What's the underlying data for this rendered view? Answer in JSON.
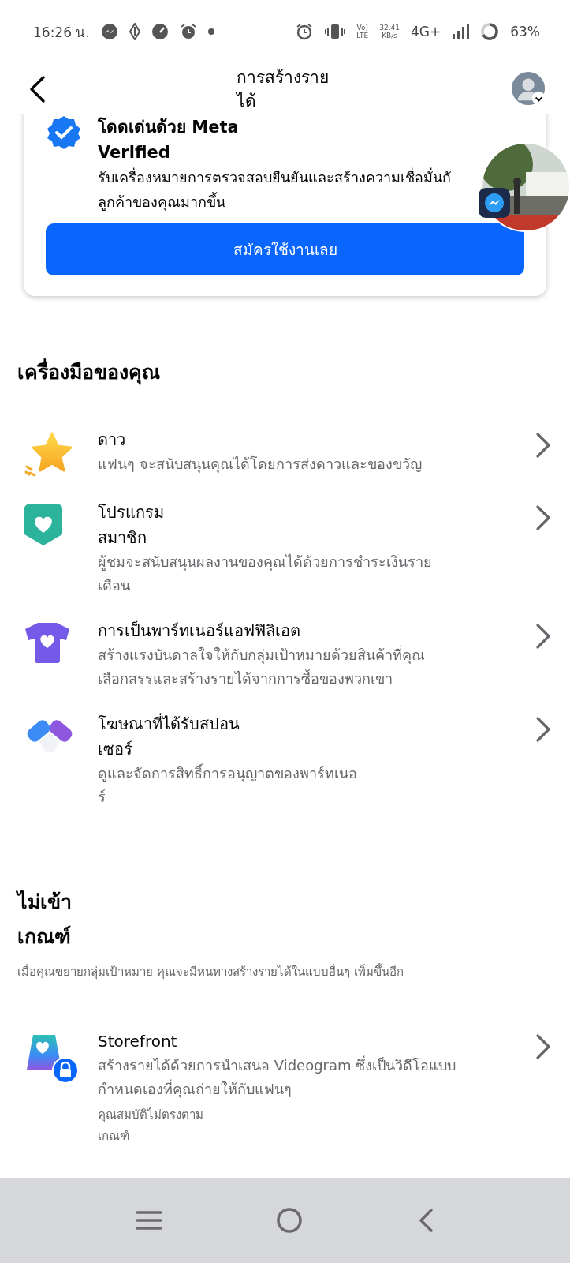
{
  "status_bar": {
    "time": "16:26 น.",
    "volte": [
      "Vo)",
      "LTE"
    ],
    "speed": [
      "32.41",
      "KB/s"
    ],
    "network": "4G+",
    "battery": "63%"
  },
  "header": {
    "title_lines": [
      "การสร้างราย",
      "ได้"
    ]
  },
  "verified_card": {
    "title_lines": [
      "โดดเด่นด้วย Meta",
      "Verified"
    ],
    "description_lines": [
      "รับเครื่องหมายการตรวจสอบยืนยันและสร้างความเชื่อมั่นกั",
      "ลูกค้าของคุณมากขึ้น"
    ],
    "button": "สมัครใช้งานเลย"
  },
  "tools": {
    "heading": "เครื่องมือของคุณ",
    "items": [
      {
        "title_lines": [
          "ดาว"
        ],
        "description_lines": [
          "แฟนๆ จะสนับสนุนคุณได้โดยการส่งดาวและของขวัญ"
        ],
        "locked": false
      },
      {
        "title_lines": [
          "โปรแกรม",
          "สมาชิก"
        ],
        "description_lines": [
          "ผู้ชมจะสนับสนุนผลงานของคุณได้ด้วยการชำระเงินราย",
          "เดือน"
        ],
        "locked": false
      },
      {
        "title_lines": [
          "การเป็นพาร์ทเนอร์แอฟฟิลิเอต"
        ],
        "description_lines": [
          "สร้างแรงบันดาลใจให้กับกลุ่มเป้าหมายด้วยสินค้าที่คุณ",
          "เลือกสรรและสร้างรายได้จากการซื้อของพวกเขา"
        ],
        "locked": false
      },
      {
        "title_lines": [
          "โฆษณาที่ได้รับสปอน",
          "เซอร์"
        ],
        "description_lines": [
          "ดูและจัดการสิทธิ์การอนุญาตของพาร์ทเนอ",
          "ร์"
        ],
        "locked": false
      }
    ]
  },
  "ineligible": {
    "heading_lines": [
      "ไม่เข้า",
      "เกณฑ์"
    ],
    "description": "เมื่อคุณขยายกลุ่มเป้าหมาย คุณจะมีหนทางสร้างรายได้ในแบบอื่นๆ เพิ่มขึ้นอีก",
    "items": [
      {
        "title_lines": [
          "Storefront"
        ],
        "description_lines": [
          "สร้างรายได้ด้วยการนำเสนอ Videogram ซึ่งเป็นวิดีโอแบบ",
          "กำหนดเองที่คุณถ่ายให้กับแฟนๆ"
        ],
        "note_lines": [
          "คุณสมบัติไม่ตรงตาม",
          "เกณฑ์"
        ],
        "locked": true
      }
    ]
  }
}
